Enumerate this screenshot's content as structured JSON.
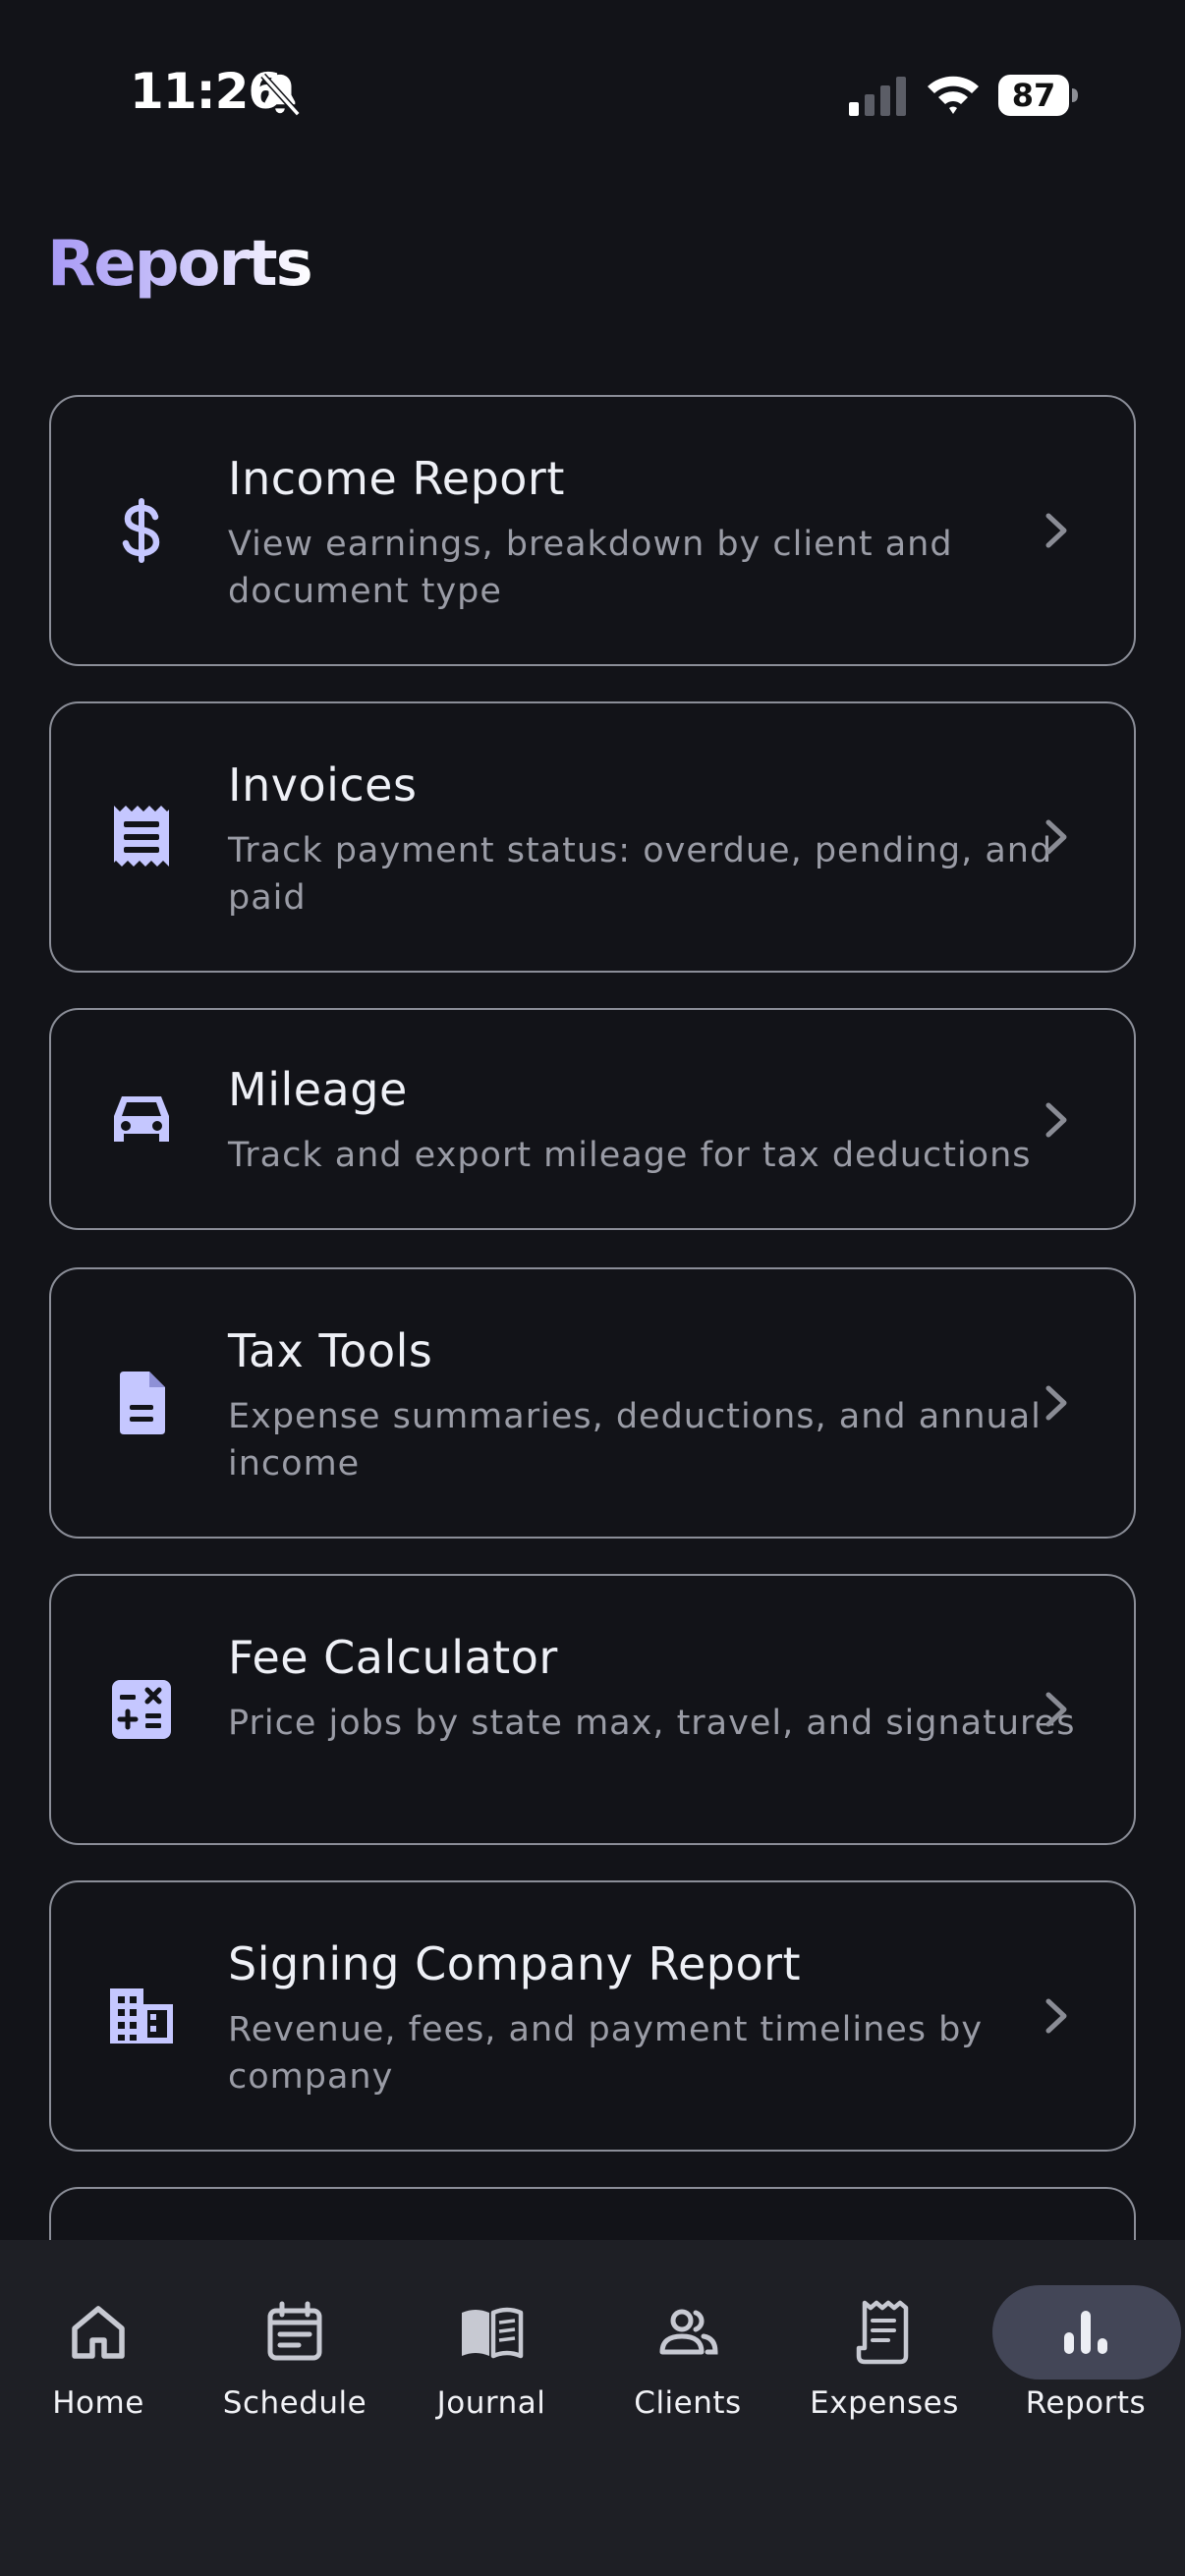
{
  "status_bar": {
    "time": "11:26",
    "battery": "87",
    "icons": [
      "bell-slash-icon",
      "cellular-signal-icon",
      "wifi-icon",
      "battery-icon"
    ]
  },
  "header": {
    "title": "Reports"
  },
  "colors": {
    "background": "#121318",
    "accent": "#c5c7ff",
    "title_gradient_start": "#a89af5",
    "card_border": "#8b8e98",
    "nav_background": "#1e1f25",
    "nav_active_pill": "#434657"
  },
  "reports": [
    {
      "title": "Income Report",
      "description": "View earnings, breakdown by client and document type",
      "icon": "dollar-icon"
    },
    {
      "title": "Invoices",
      "description": "Track payment status: overdue, pending, and paid",
      "icon": "receipt-icon"
    },
    {
      "title": "Mileage",
      "description": "Track and export mileage for tax deductions",
      "icon": "car-icon"
    },
    {
      "title": "Tax Tools",
      "description": "Expense summaries, deductions, and annual income",
      "icon": "document-icon"
    },
    {
      "title": "Fee Calculator",
      "description": "Price jobs by state max, travel, and signatures",
      "icon": "calculator-icon"
    },
    {
      "title": "Signing Company Report",
      "description": "Revenue, fees, and payment timelines by company",
      "icon": "building-icon"
    }
  ],
  "nav": {
    "active": "Reports",
    "items": [
      {
        "label": "Home",
        "icon": "home-icon"
      },
      {
        "label": "Schedule",
        "icon": "calendar-icon"
      },
      {
        "label": "Journal",
        "icon": "book-icon"
      },
      {
        "label": "Clients",
        "icon": "people-icon"
      },
      {
        "label": "Expenses",
        "icon": "receipt-list-icon"
      },
      {
        "label": "Reports",
        "icon": "bar-chart-icon"
      }
    ]
  }
}
